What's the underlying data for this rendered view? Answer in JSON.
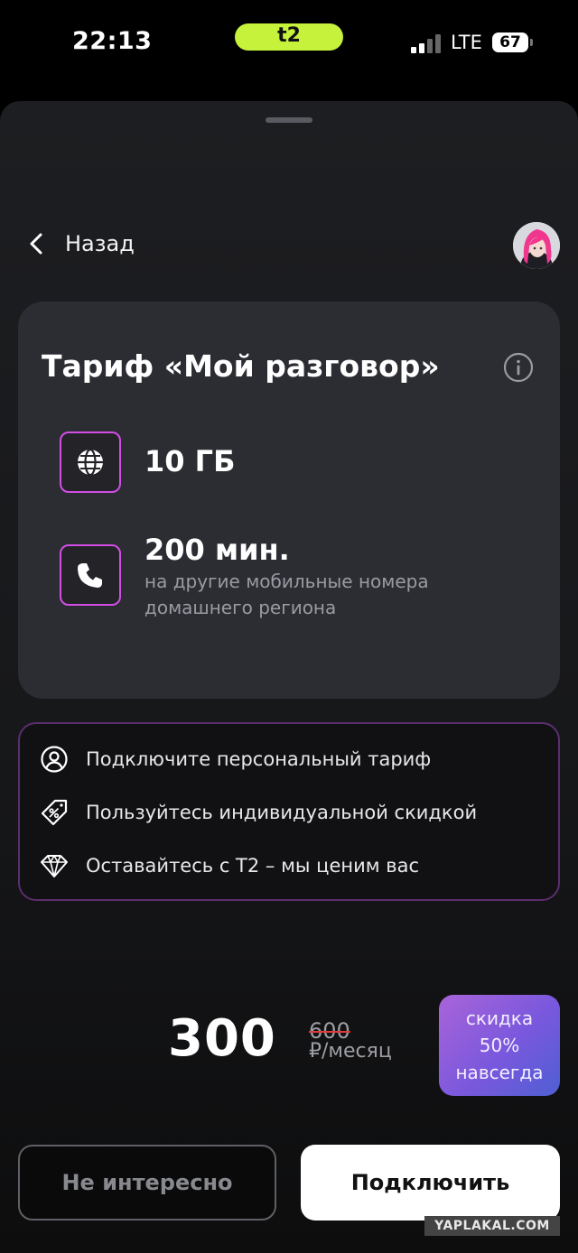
{
  "status_bar": {
    "time": "22:13",
    "carrier_logo": "t2",
    "network": "LTE",
    "battery": "67",
    "pill_color": "#c6f23b"
  },
  "header": {
    "back_label": "Назад",
    "back_icon": "chevron-left-icon",
    "avatar": "avatar"
  },
  "tariff": {
    "title": "Тариф «Мой разговор»",
    "info_icon": "info-icon",
    "features": [
      {
        "icon": "globe-icon",
        "title": "10 ГБ",
        "subtitle": ""
      },
      {
        "icon": "phone-icon",
        "title": "200 мин.",
        "subtitle": "на другие мобильные номера домашнего региона"
      }
    ]
  },
  "benefits": [
    {
      "icon": "user-circle-icon",
      "text": "Подключите персональный тариф"
    },
    {
      "icon": "discount-tag-icon",
      "text": "Пользуйтесь индивидуальной скидкой"
    },
    {
      "icon": "diamond-icon",
      "text": "Оставайтесь с Т2 – мы ценим вас"
    }
  ],
  "pricing": {
    "price": "300",
    "old_price": "600",
    "period": "₽/месяц",
    "discount_lines": [
      "скидка",
      "50%",
      "навсегда"
    ]
  },
  "actions": {
    "decline_label": "Не интересно",
    "connect_label": "Подключить"
  },
  "watermark": "YAPLAKAL.COM",
  "colors": {
    "accent_border": "#d24ee5",
    "card_bg": "#2c2d33",
    "discount_gradient": [
      "#a964d9",
      "#4e5fd4"
    ]
  }
}
